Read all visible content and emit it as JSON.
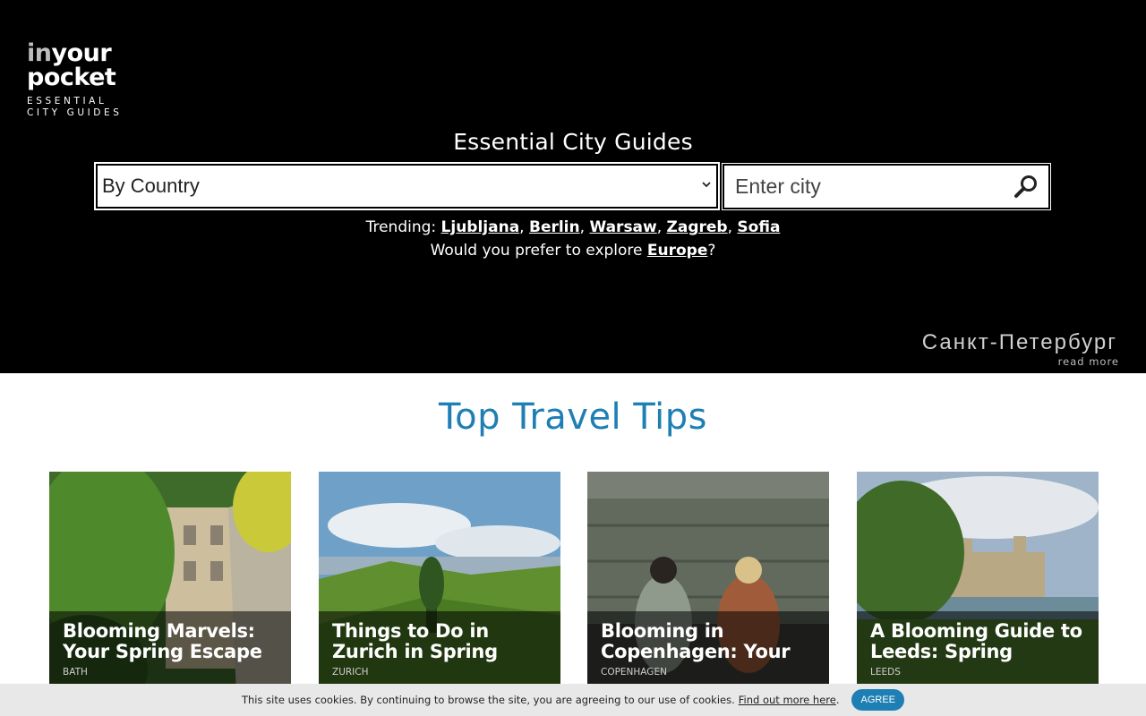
{
  "logo": {
    "line1_a": "in",
    "line1_b": "your",
    "line2": "pocket",
    "tag1": "ESSENTIAL",
    "tag2": "CITY GUIDES"
  },
  "hero": {
    "title": "Essential City Guides",
    "country_select": {
      "value": "By Country"
    },
    "city_input": {
      "placeholder": "Enter city"
    },
    "trending_label": "Trending:",
    "trending": [
      "Ljubljana",
      "Berlin",
      "Warsaw",
      "Zagreb",
      "Sofia"
    ],
    "explore_prefix": "Would you prefer to explore ",
    "explore_link": "Europe",
    "explore_suffix": "?",
    "feature_city": "Санкт-Петербург",
    "read_more": "read more"
  },
  "section": {
    "title": "Top Travel Tips"
  },
  "cards": [
    {
      "title": "Blooming Marvels: Your Spring Escape in",
      "city": "BATH"
    },
    {
      "title": "Things to Do in Zurich in Spring",
      "city": "ZURICH"
    },
    {
      "title": "Blooming in Copenhagen: Your",
      "city": "COPENHAGEN"
    },
    {
      "title": "A Blooming Guide to Leeds: Spring",
      "city": "LEEDS"
    }
  ],
  "cookie": {
    "text": "This site uses cookies. By continuing to browse the site, you are agreeing to our use of cookies.",
    "link": "Find out more here",
    "dot": ".",
    "agree": "AGREE"
  },
  "colors": {
    "accent": "#1e7fb4",
    "hero_bg": "#000000",
    "cookie_bg": "#e8e8e8"
  }
}
